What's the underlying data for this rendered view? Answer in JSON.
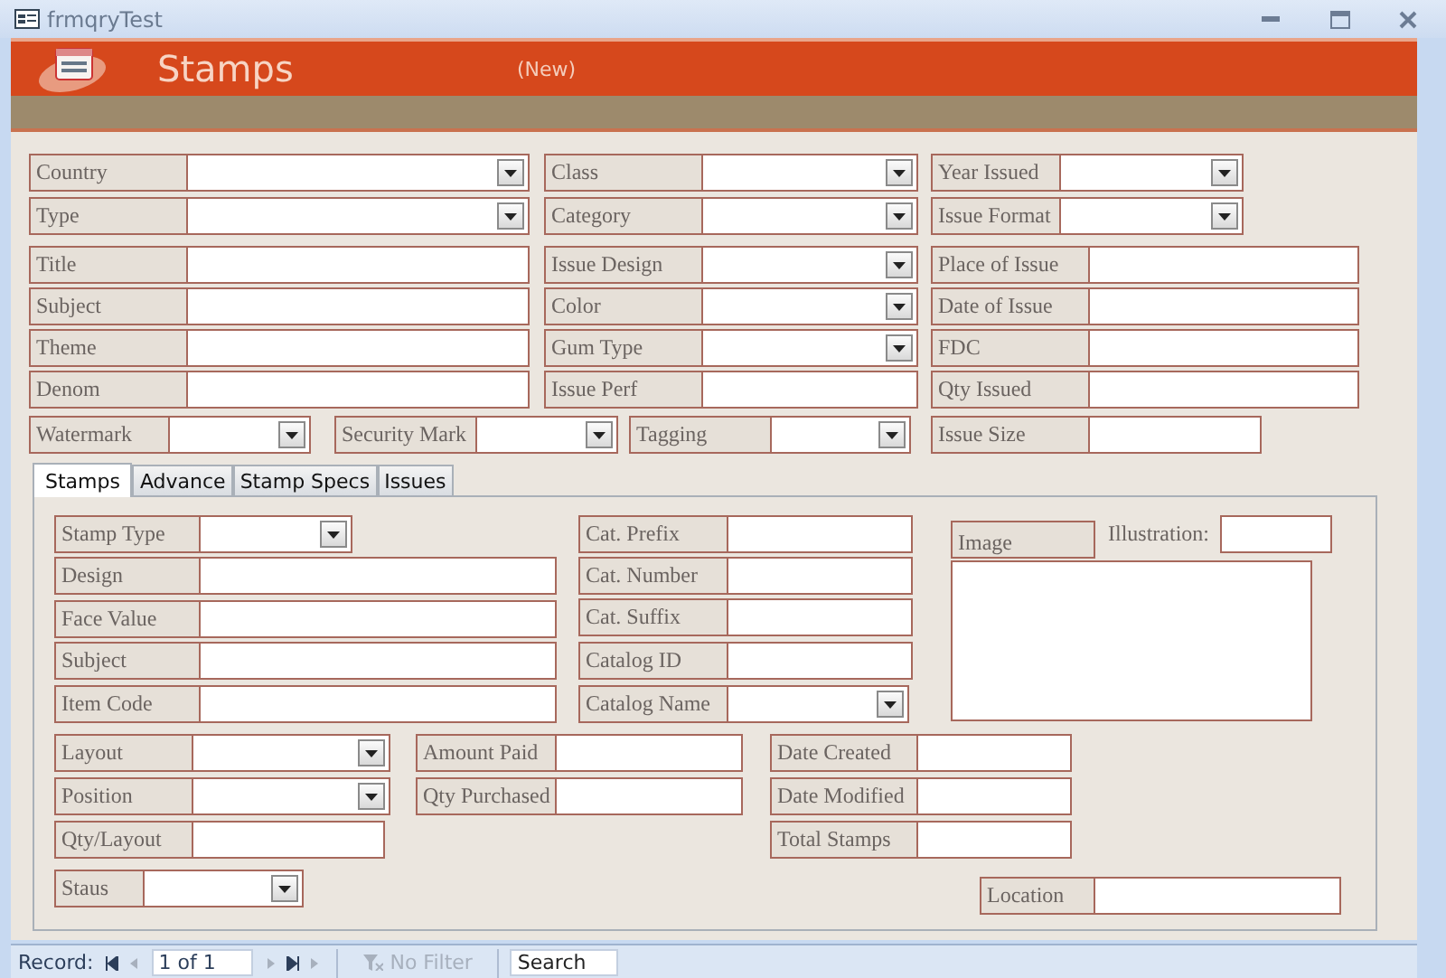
{
  "window": {
    "title": "frmqryTest"
  },
  "header": {
    "title": "Stamps",
    "record_state": "(New)"
  },
  "fields": [
    {
      "label": "Country",
      "kind": "combo"
    },
    {
      "label": "Class",
      "kind": "combo"
    },
    {
      "label": "Year Issued",
      "kind": "combo"
    },
    {
      "label": "Type",
      "kind": "combo"
    },
    {
      "label": "Category",
      "kind": "combo"
    },
    {
      "label": "Issue Format",
      "kind": "combo"
    },
    {
      "label": "Title",
      "kind": "text"
    },
    {
      "label": "Issue Design",
      "kind": "combo"
    },
    {
      "label": "Place of Issue",
      "kind": "text"
    },
    {
      "label": "Subject",
      "kind": "text"
    },
    {
      "label": "Color",
      "kind": "combo"
    },
    {
      "label": "Date of Issue",
      "kind": "text"
    },
    {
      "label": "Theme",
      "kind": "text"
    },
    {
      "label": "Gum Type",
      "kind": "combo"
    },
    {
      "label": "FDC",
      "kind": "text"
    },
    {
      "label": "Denom",
      "kind": "text"
    },
    {
      "label": "Issue Perf",
      "kind": "text"
    },
    {
      "label": "Qty Issued",
      "kind": "text"
    },
    {
      "label": "Watermark",
      "kind": "combo"
    },
    {
      "label": "Security Mark",
      "kind": "combo"
    },
    {
      "label": "Tagging",
      "kind": "combo"
    },
    {
      "label": "Issue Size",
      "kind": "text"
    }
  ],
  "tabs": [
    {
      "label": "Stamps",
      "selected": true
    },
    {
      "label": "Advance",
      "selected": false
    },
    {
      "label": "Stamp Specs",
      "selected": false
    },
    {
      "label": "Issues",
      "selected": false
    }
  ],
  "tab_fields": [
    {
      "label": "Stamp Type",
      "kind": "combo"
    },
    {
      "label": "Cat. Prefix",
      "kind": "text"
    },
    {
      "label": "Image",
      "kind": "image"
    },
    {
      "label": "Illustration:",
      "kind": "caption"
    },
    {
      "label": "Design",
      "kind": "text"
    },
    {
      "label": "Cat. Number",
      "kind": "text"
    },
    {
      "label": "Face Value",
      "kind": "text"
    },
    {
      "label": "Cat. Suffix",
      "kind": "text"
    },
    {
      "label": "Subject",
      "kind": "text"
    },
    {
      "label": "Catalog ID",
      "kind": "text"
    },
    {
      "label": "Item Code",
      "kind": "text"
    },
    {
      "label": "Catalog Name",
      "kind": "combo"
    },
    {
      "label": "Layout",
      "kind": "combo"
    },
    {
      "label": "Amount Paid",
      "kind": "text"
    },
    {
      "label": "Date Created",
      "kind": "text"
    },
    {
      "label": "Position",
      "kind": "combo"
    },
    {
      "label": "Qty Purchased",
      "kind": "text"
    },
    {
      "label": "Date Modified",
      "kind": "text"
    },
    {
      "label": "Qty/Layout",
      "kind": "text"
    },
    {
      "label": "Total Stamps",
      "kind": "text"
    },
    {
      "label": "Staus",
      "kind": "combo"
    },
    {
      "label": "Location",
      "kind": "text"
    }
  ],
  "status_bar": {
    "record_label": "Record:",
    "record_position": "1 of 1",
    "filter": "No Filter",
    "search": {
      "placeholder": "Search"
    }
  }
}
